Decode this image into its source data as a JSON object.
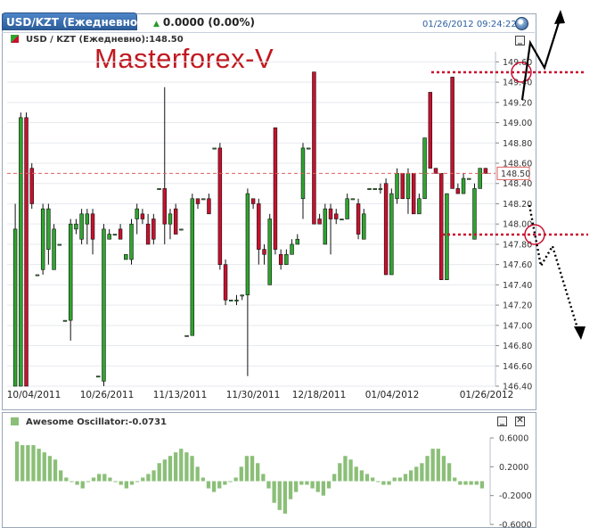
{
  "header": {
    "tab_label": "USD/KZT (Ежедневно)",
    "change_label": "0.0000 (0.00%)",
    "datetime": "01/26/2012 09:24:22"
  },
  "main_panel": {
    "legend_label": "USD / KZT (Ежедневно):148.50",
    "minimize_label": "_"
  },
  "watermark": "Masterforex-V",
  "oscillator_panel": {
    "legend_label": "Awesome Oscillator:-0.0731",
    "minimize_label": "_",
    "close_label": "✕"
  },
  "colors": {
    "up": "#2fa52f",
    "down": "#c8102e",
    "oscillator": "#8bbf78",
    "annotation": "#c8102e",
    "header": "#2c5d9a"
  },
  "chart_data": [
    {
      "type": "candlestick",
      "title": "USD / KZT (Ежедневно):148.50",
      "ylim": [
        146.4,
        149.7
      ],
      "y_ticks": [
        "149.60",
        "149.40",
        "149.20",
        "149.00",
        "148.80",
        "148.60",
        "148.40",
        "148.20",
        "148.00",
        "147.80",
        "147.60",
        "147.40",
        "147.20",
        "147.00",
        "146.80",
        "146.60",
        "146.40"
      ],
      "x_ticks": [
        "10/04/2011",
        "10/26/2011",
        "11/13/2011",
        "11/30/2011",
        "12/18/2011",
        "01/04/2012",
        "01/26/2012"
      ],
      "current_value_label": "148.50",
      "current_value": 148.5,
      "candles": [
        [
          146.4,
          147.95,
          146.4,
          148.2
        ],
        [
          146.4,
          149.05,
          146.4,
          149.1
        ],
        [
          149.05,
          146.4,
          146.4,
          149.1
        ],
        [
          148.55,
          148.2,
          148.15,
          148.6
        ],
        [
          147.5,
          147.5,
          147.5,
          147.5
        ],
        [
          147.55,
          148.15,
          147.5,
          148.2
        ],
        [
          147.75,
          148.15,
          147.6,
          148.2
        ],
        [
          147.55,
          147.95,
          147.55,
          148.0
        ],
        [
          147.8,
          147.8,
          147.8,
          147.8
        ],
        [
          147.05,
          147.05,
          147.05,
          147.05
        ],
        [
          147.05,
          148.0,
          146.85,
          148.05
        ],
        [
          147.95,
          148.0,
          147.9,
          148.05
        ],
        [
          147.85,
          148.1,
          147.8,
          148.15
        ],
        [
          148.0,
          148.1,
          147.8,
          148.15
        ],
        [
          148.1,
          147.85,
          147.7,
          148.15
        ],
        [
          146.5,
          146.5,
          146.5,
          146.5
        ],
        [
          146.45,
          147.95,
          146.4,
          148.0
        ],
        [
          147.85,
          147.9,
          147.85,
          147.95
        ],
        [
          147.9,
          147.9,
          147.9,
          147.9
        ],
        [
          147.95,
          147.85,
          147.85,
          148.0
        ],
        [
          147.65,
          147.7,
          147.65,
          147.7
        ],
        [
          147.65,
          148.0,
          147.6,
          148.05
        ],
        [
          148.05,
          148.15,
          147.9,
          148.2
        ],
        [
          148.1,
          148.05,
          148.0,
          148.15
        ],
        [
          148.0,
          147.8,
          147.8,
          148.1
        ],
        [
          148.05,
          147.85,
          147.8,
          148.1
        ],
        [
          148.35,
          148.35,
          148.35,
          148.35
        ],
        [
          148.35,
          148.0,
          147.8,
          149.35
        ],
        [
          148.0,
          148.1,
          147.85,
          148.15
        ],
        [
          148.15,
          147.9,
          147.9,
          148.2
        ],
        [
          147.95,
          147.95,
          147.95,
          147.95
        ],
        [
          146.9,
          146.9,
          146.9,
          146.9
        ],
        [
          146.9,
          148.25,
          146.9,
          148.3
        ],
        [
          148.25,
          148.2,
          148.15,
          148.25
        ],
        [
          148.25,
          148.25,
          148.25,
          148.25
        ],
        [
          148.25,
          148.1,
          148.1,
          148.3
        ],
        [
          148.75,
          148.75,
          148.75,
          148.75
        ],
        [
          148.75,
          147.6,
          147.55,
          148.8
        ],
        [
          147.6,
          147.25,
          147.2,
          147.65
        ],
        [
          147.25,
          147.25,
          147.25,
          147.25
        ],
        [
          147.25,
          147.25,
          147.2,
          147.3
        ],
        [
          147.3,
          147.3,
          147.25,
          147.3
        ],
        [
          147.3,
          148.3,
          146.5,
          148.35
        ],
        [
          148.25,
          148.2,
          148.15,
          148.25
        ],
        [
          148.2,
          147.75,
          147.6,
          148.25
        ],
        [
          147.75,
          147.7,
          147.6,
          147.8
        ],
        [
          147.4,
          148.05,
          147.4,
          148.1
        ],
        [
          148.95,
          147.75,
          147.7,
          148.95
        ],
        [
          147.7,
          147.6,
          147.55,
          147.75
        ],
        [
          147.6,
          147.7,
          147.6,
          147.75
        ],
        [
          147.7,
          147.8,
          147.7,
          147.85
        ],
        [
          147.8,
          147.85,
          147.8,
          147.9
        ],
        [
          148.25,
          148.75,
          148.05,
          148.8
        ],
        [
          148.75,
          148.75,
          148.75,
          148.75
        ],
        [
          149.5,
          148.0,
          148.0,
          149.5
        ],
        [
          148.05,
          148.0,
          148.0,
          148.1
        ],
        [
          147.8,
          148.15,
          147.8,
          148.2
        ],
        [
          148.15,
          148.05,
          147.7,
          148.2
        ],
        [
          148.1,
          148.05,
          148.0,
          148.15
        ],
        [
          148.05,
          148.05,
          148.05,
          148.05
        ],
        [
          148.05,
          148.25,
          148.05,
          148.3
        ],
        [
          148.25,
          148.25,
          148.25,
          148.25
        ],
        [
          148.2,
          147.9,
          147.85,
          148.25
        ],
        [
          147.85,
          148.1,
          147.85,
          148.15
        ],
        [
          148.35,
          148.35,
          148.35,
          148.35
        ],
        [
          148.35,
          148.35,
          148.35,
          148.35
        ],
        [
          148.35,
          148.35,
          148.3,
          148.4
        ],
        [
          148.4,
          147.5,
          147.5,
          148.45
        ],
        [
          147.5,
          148.3,
          147.5,
          148.35
        ],
        [
          148.25,
          148.5,
          148.2,
          148.55
        ],
        [
          148.5,
          148.25,
          148.25,
          148.5
        ],
        [
          148.25,
          148.5,
          148.1,
          148.55
        ],
        [
          148.5,
          148.1,
          148.1,
          148.5
        ],
        [
          148.1,
          148.25,
          148.1,
          148.3
        ],
        [
          148.25,
          148.85,
          148.25,
          148.85
        ],
        [
          149.3,
          148.55,
          148.55,
          149.3
        ],
        [
          148.55,
          148.5,
          148.5,
          148.55
        ],
        [
          148.5,
          147.45,
          147.45,
          148.5
        ],
        [
          147.45,
          148.3,
          147.45,
          148.3
        ],
        [
          149.45,
          148.35,
          148.35,
          149.45
        ],
        [
          148.35,
          148.3,
          148.3,
          148.4
        ],
        [
          148.3,
          148.45,
          148.3,
          148.5
        ],
        [
          148.45,
          148.45,
          148.45,
          148.45
        ],
        [
          147.85,
          148.35,
          147.85,
          148.4
        ],
        [
          148.35,
          148.55,
          148.35,
          148.55
        ],
        [
          148.55,
          148.5,
          148.5,
          148.55
        ]
      ]
    },
    {
      "type": "bar",
      "title": "Awesome Oscillator:-0.0731",
      "ylim": [
        -0.6,
        0.6
      ],
      "y_ticks": [
        "0.6000",
        "0.2000",
        "-0.2000",
        "-0.6000"
      ],
      "values": [
        0.55,
        0.5,
        0.5,
        0.5,
        0.45,
        0.4,
        0.35,
        0.3,
        0.15,
        0.05,
        0.0,
        -0.05,
        -0.1,
        0.0,
        0.05,
        0.1,
        0.1,
        0.05,
        0.0,
        -0.05,
        -0.1,
        -0.05,
        0.0,
        0.05,
        0.1,
        0.15,
        0.25,
        0.3,
        0.35,
        0.4,
        0.45,
        0.4,
        0.35,
        0.2,
        0.05,
        -0.1,
        -0.15,
        -0.1,
        -0.05,
        0.0,
        0.05,
        0.2,
        0.35,
        0.35,
        0.25,
        0.1,
        -0.1,
        -0.3,
        -0.4,
        -0.45,
        -0.25,
        -0.15,
        -0.05,
        -0.05,
        -0.1,
        -0.15,
        -0.2,
        -0.1,
        0.1,
        0.25,
        0.35,
        0.3,
        0.2,
        0.15,
        0.1,
        0.05,
        0.0,
        -0.05,
        -0.05,
        0.05,
        0.05,
        0.1,
        0.15,
        0.2,
        0.25,
        0.35,
        0.45,
        0.45,
        0.35,
        0.25,
        0.05,
        -0.05,
        -0.05,
        -0.05,
        -0.05,
        -0.1
      ]
    }
  ]
}
